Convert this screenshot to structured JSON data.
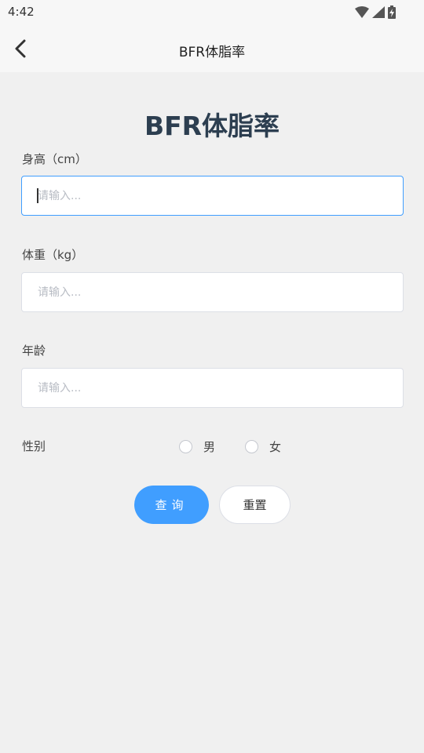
{
  "status_bar": {
    "time": "4:42"
  },
  "app_bar": {
    "title": "BFR体脂率"
  },
  "form": {
    "heading": "BFR体脂率",
    "height_label": "身高（cm）",
    "weight_label": "体重（kg）",
    "age_label": "年龄",
    "placeholder": "请输入...",
    "gender_label": "性别",
    "gender_options": [
      "男",
      "女"
    ],
    "query_button": "查询",
    "reset_button": "重置"
  }
}
